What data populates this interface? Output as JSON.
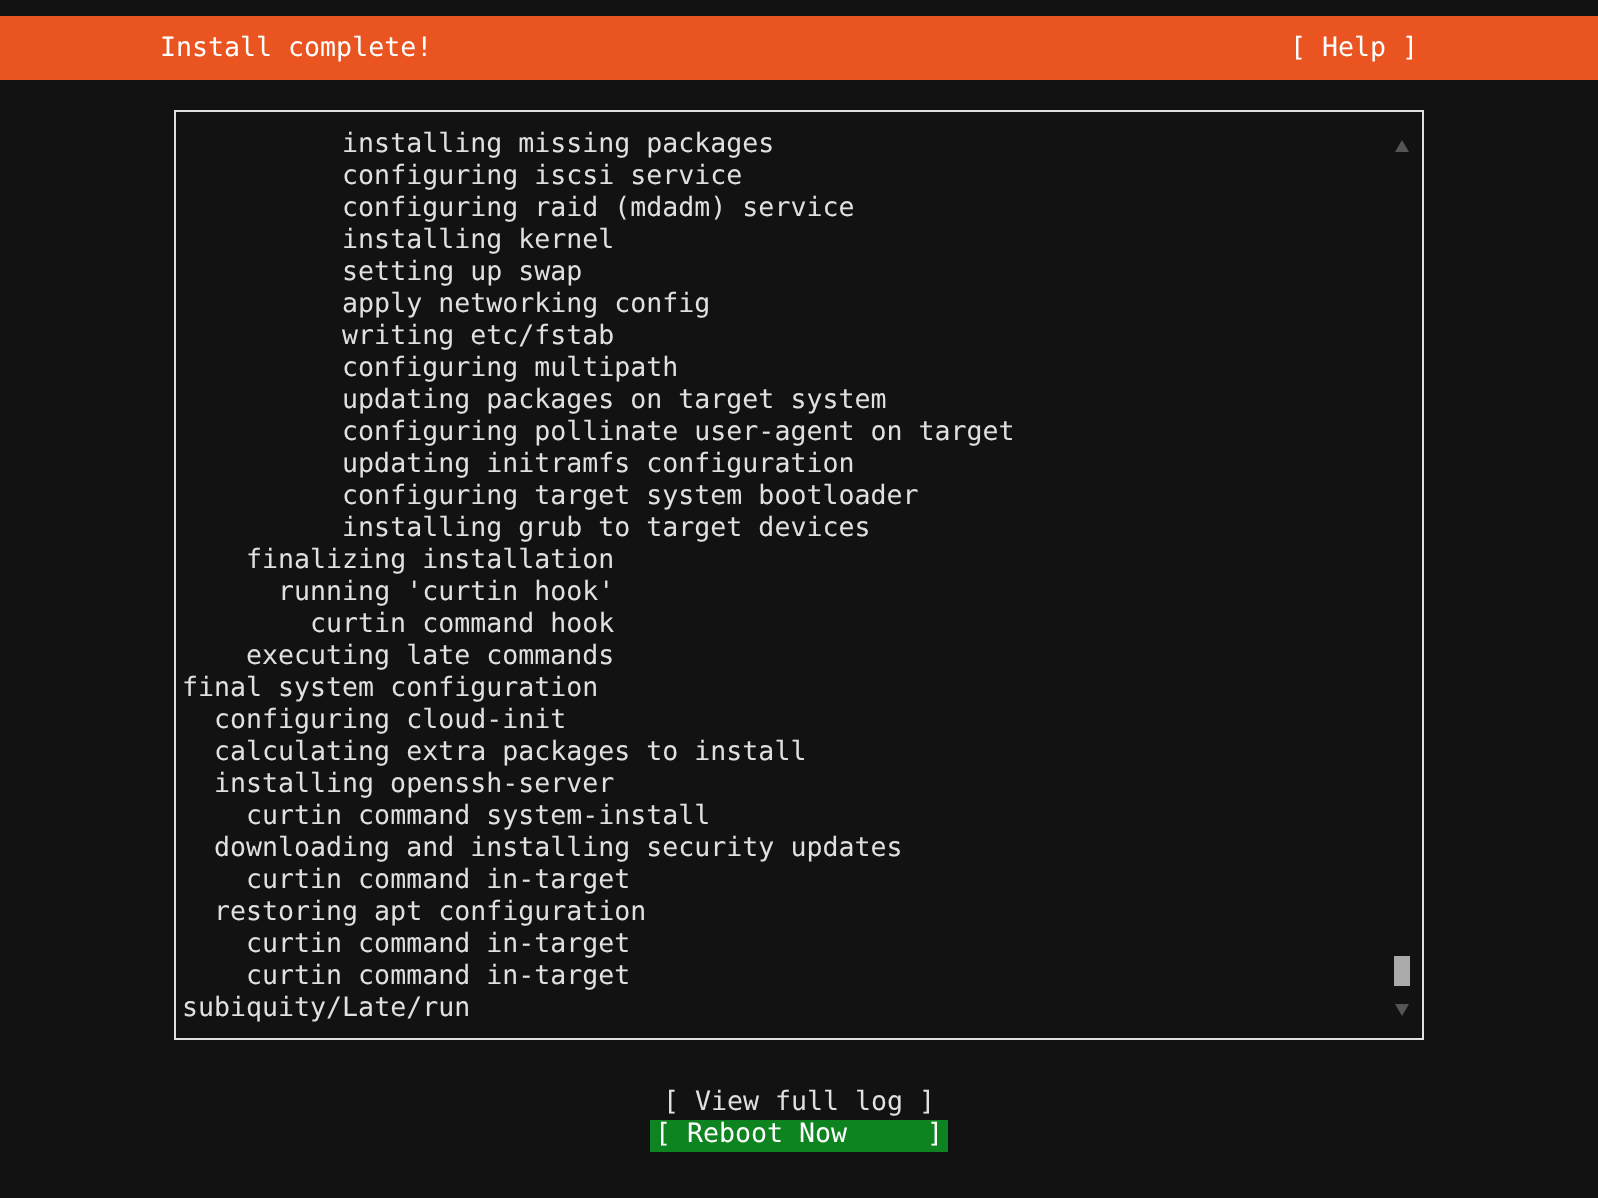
{
  "header": {
    "title": "Install complete!",
    "help": "[ Help ]"
  },
  "log": [
    {
      "children": [
        {
          "children": [
            {
              "children": [
                {
                  "children": [
                    {
                      "children": [
                        {
                          "text": "installing missing packages"
                        },
                        {
                          "text": "configuring iscsi service"
                        },
                        {
                          "text": "configuring raid (mdadm) service"
                        },
                        {
                          "text": "installing kernel"
                        },
                        {
                          "text": "setting up swap"
                        },
                        {
                          "text": "apply networking config"
                        },
                        {
                          "text": "writing etc/fstab"
                        },
                        {
                          "text": "configuring multipath"
                        },
                        {
                          "text": "updating packages on target system"
                        },
                        {
                          "text": "configuring pollinate user-agent on target"
                        },
                        {
                          "text": "updating initramfs configuration"
                        },
                        {
                          "text": "configuring target system bootloader"
                        },
                        {
                          "text": "installing grub to target devices"
                        }
                      ]
                    }
                  ]
                }
              ]
            },
            {
              "text": "finalizing installation",
              "children": [
                {
                  "text": "running 'curtin hook'",
                  "children": [
                    {
                      "text": "curtin command hook"
                    }
                  ]
                }
              ]
            },
            {
              "text": "executing late commands"
            }
          ]
        }
      ]
    },
    {
      "text": "final system configuration",
      "children": [
        {
          "text": "configuring cloud-init"
        },
        {
          "text": "calculating extra packages to install"
        },
        {
          "text": "installing openssh-server",
          "children": [
            {
              "text": "curtin command system-install"
            }
          ]
        },
        {
          "text": "downloading and installing security updates",
          "children": [
            {
              "text": "curtin command in-target"
            }
          ]
        },
        {
          "text": "restoring apt configuration",
          "children": [
            {
              "text": "curtin command in-target"
            },
            {
              "text": "curtin command in-target"
            }
          ]
        }
      ]
    },
    {
      "text": "subiquity/Late/run"
    }
  ],
  "buttons": [
    {
      "label": "[ View full log ]",
      "selected": false
    },
    {
      "label": "[ Reboot Now     ]",
      "selected": true
    }
  ]
}
